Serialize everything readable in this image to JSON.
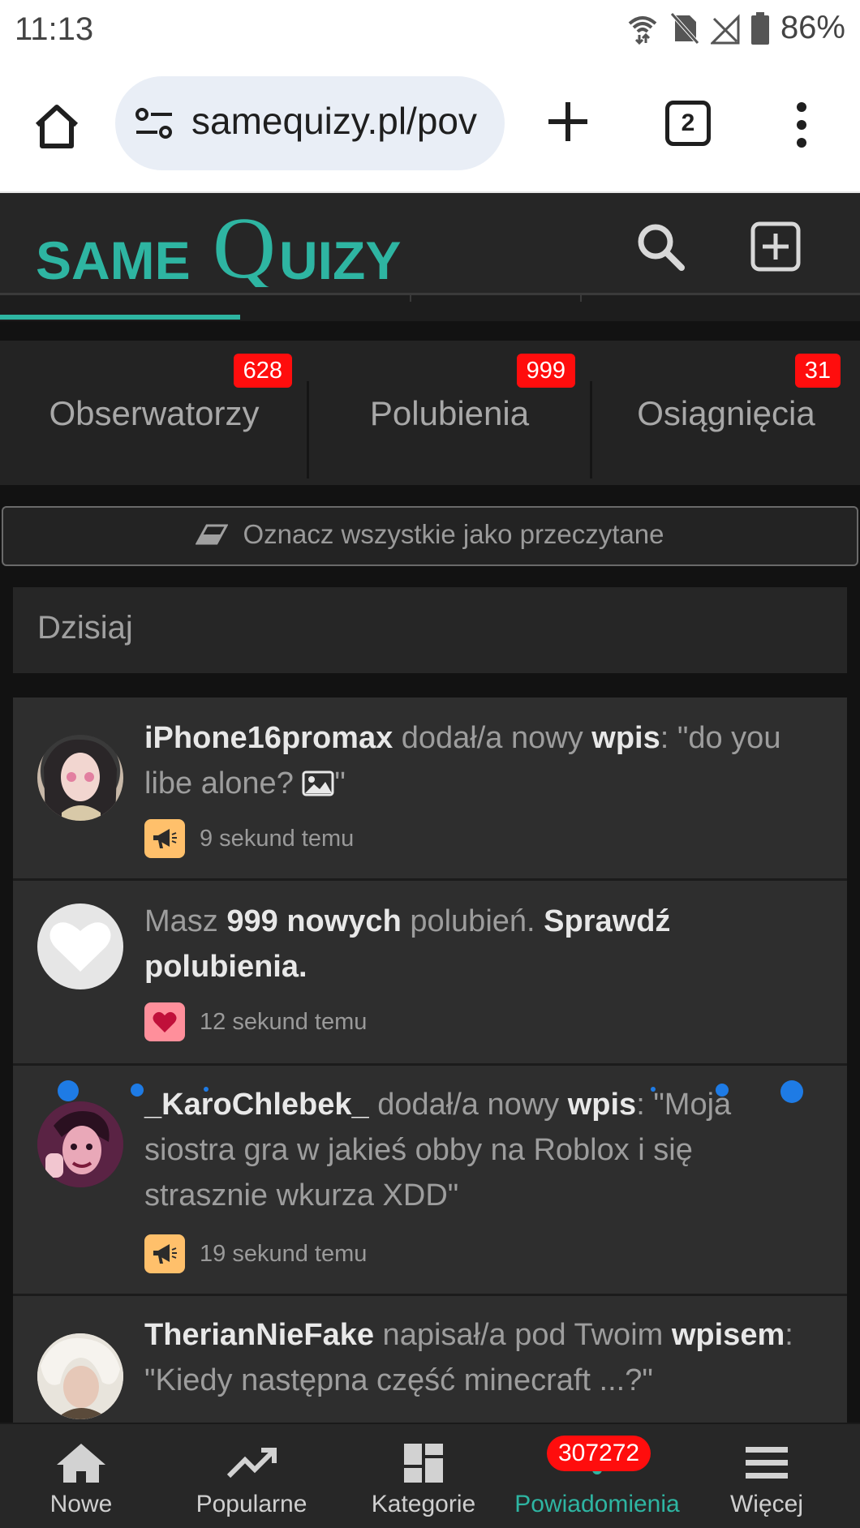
{
  "status_bar": {
    "time": "11:13",
    "battery": "86%",
    "icons": [
      "wifi-icon",
      "no-sim-icon",
      "signal-off-icon",
      "battery-icon"
    ]
  },
  "browser": {
    "url": "samequizy.pl/pov",
    "tab_count": "2",
    "icons": [
      "home-icon",
      "tune-icon",
      "plus-icon",
      "tabs-icon",
      "overflow-menu-icon"
    ]
  },
  "site": {
    "logo_text_left": "SAME",
    "logo_text_q": "Q",
    "logo_text_right": "UIZY",
    "brand_color": "#2eb5a2"
  },
  "tabs": [
    {
      "label": "Obserwatorzy",
      "badge": "628"
    },
    {
      "label": "Polubienia",
      "badge": "999"
    },
    {
      "label": "Osiągnięcia",
      "badge": "31"
    }
  ],
  "mark_all_read": "Oznacz wszystkie jako przeczytane",
  "day_header": "Dzisiaj",
  "notifications": [
    {
      "user": "iPhone16promax",
      "action": " dodał/a nowy ",
      "object": "wpis",
      "content_prefix": ": \"do you libe alone? ",
      "content_suffix": "\"",
      "time": "9 sekund temu",
      "type_icon": "megaphone-icon"
    },
    {
      "prefix": "Masz ",
      "count_text": "999 nowych",
      "middle": " polubień. ",
      "link": "Sprawdź polubienia.",
      "time": "12 sekund temu",
      "type_icon": "heart-icon"
    },
    {
      "user": "_KaroChlebek_",
      "action": " dodał/a nowy ",
      "object": "wpis",
      "content": ": \"Moja siostra gra w jakieś obby na Roblox i się strasznie wkurza XDD\"",
      "time": "19 sekund temu",
      "type_icon": "megaphone-icon"
    },
    {
      "user": "TherianNieFake",
      "action": " napisał/a pod Twoim ",
      "object": "wpisem",
      "content": ": \"Kiedy następna część minecraft ...?\""
    }
  ],
  "bottom_nav": [
    {
      "label": "Nowe",
      "icon": "home-icon"
    },
    {
      "label": "Popularne",
      "icon": "trending-icon"
    },
    {
      "label": "Kategorie",
      "icon": "dashboard-icon"
    },
    {
      "label": "Powiadomienia",
      "icon": "bell-icon",
      "badge": "307272",
      "active": true
    },
    {
      "label": "Więcej",
      "icon": "menu-icon"
    }
  ]
}
